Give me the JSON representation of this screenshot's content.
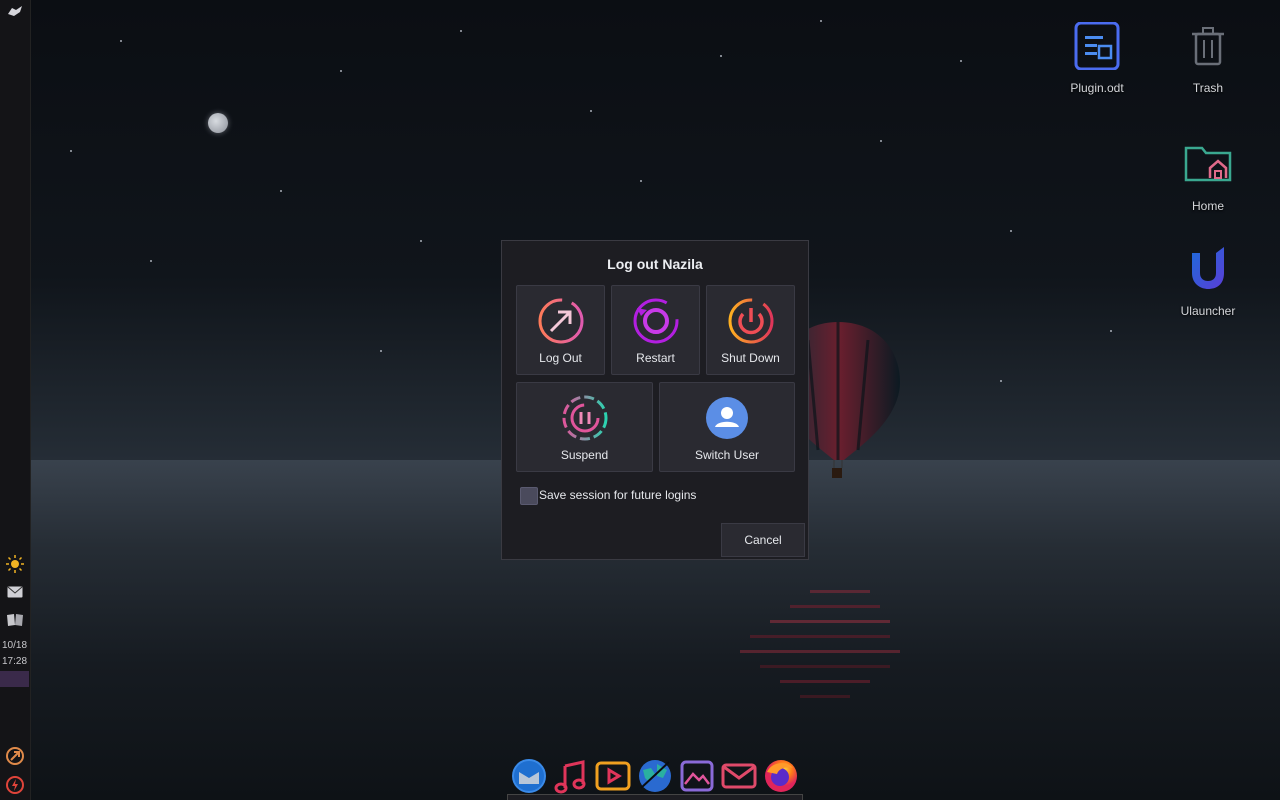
{
  "desktop": {
    "icons": [
      {
        "label": "Plugin.odt",
        "icon": "document-icon"
      },
      {
        "label": "Trash",
        "icon": "trash-icon"
      },
      {
        "label": "Home",
        "icon": "home-folder-icon"
      },
      {
        "label": "Ulauncher",
        "icon": "ulauncher-icon"
      }
    ]
  },
  "panel": {
    "date": "10/18",
    "time": "17:28",
    "items": [
      "whisker-menu-icon",
      "weather-icon",
      "mail-icon",
      "book-icon",
      "logout-icon",
      "power-icon"
    ]
  },
  "dialog": {
    "title": "Log out Nazila",
    "buttons": {
      "logout": "Log Out",
      "restart": "Restart",
      "shutdown": "Shut Down",
      "suspend": "Suspend",
      "switch_user": "Switch User"
    },
    "save_session_label": "Save session for future logins",
    "save_session_checked": false,
    "cancel": "Cancel"
  },
  "dock": {
    "apps": [
      "thunderbird-icon",
      "music-icon",
      "video-player-icon",
      "browser-globe-icon",
      "image-viewer-icon",
      "mail-client-icon",
      "firefox-icon"
    ]
  },
  "colors": {
    "dialog_bg": "#1d1d22",
    "button_bg": "#2a2a31",
    "accent_pink": "#e0559b",
    "accent_purple": "#b21fe0",
    "accent_orange": "#ff8a3d"
  }
}
